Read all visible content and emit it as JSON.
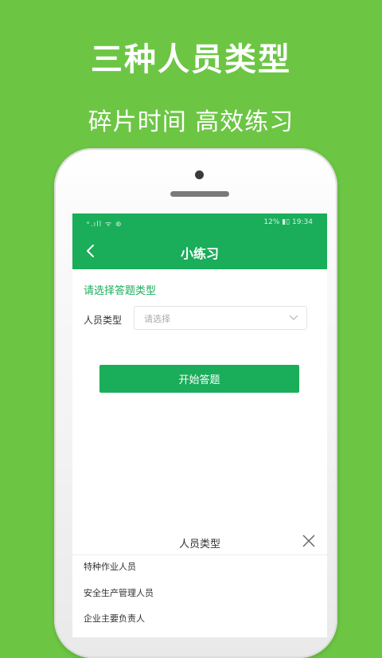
{
  "promo": {
    "headline": "三种人员类型",
    "subheadline": "碎片时间 高效练习"
  },
  "statusbar": {
    "left": "ᵉ.ıll ᯤ ⊛",
    "right": "12% ▮▯ 19:34"
  },
  "navbar": {
    "title": "小练习",
    "back_icon": "chevron-left-icon"
  },
  "form": {
    "section_title": "请选择答题类型",
    "field_label": "人员类型",
    "select_placeholder": "请选择",
    "start_button": "开始答题"
  },
  "sheet": {
    "title": "人员类型",
    "options": [
      {
        "label": "特种作业人员"
      },
      {
        "label": "安全生产管理人员"
      },
      {
        "label": "企业主要负责人"
      }
    ]
  },
  "colors": {
    "background": "#6cc644",
    "brand": "#1aad5a"
  }
}
